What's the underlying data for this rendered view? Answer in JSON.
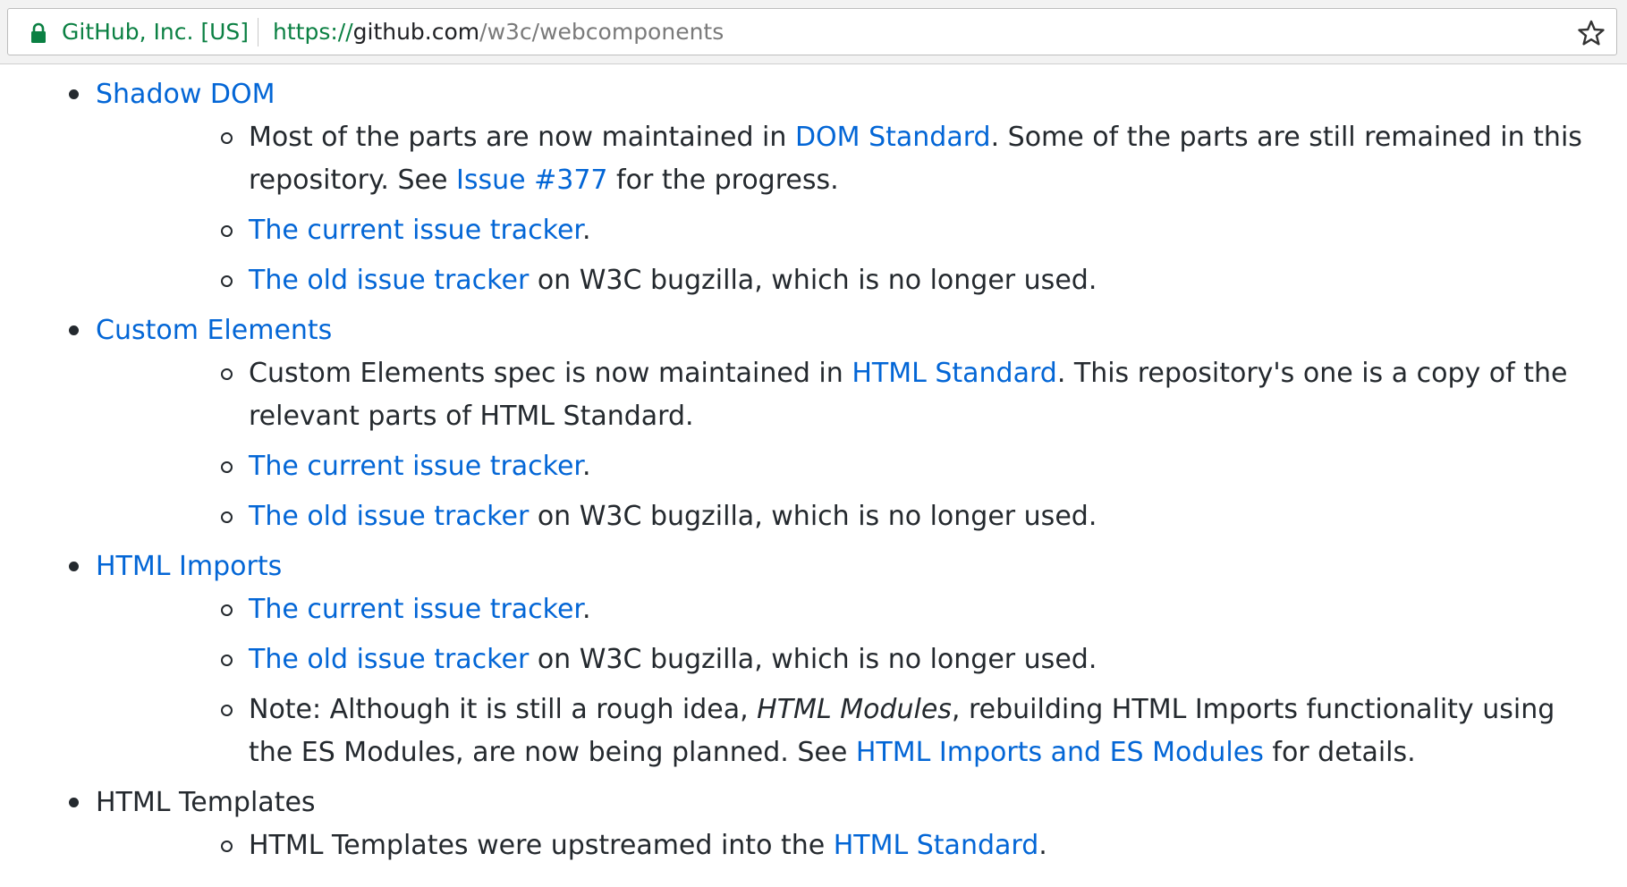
{
  "browser": {
    "site_identity": "GitHub, Inc. [US]",
    "url_scheme": "https://",
    "url_host": "github.com",
    "url_path": "/w3c/webcomponents",
    "secure_color": "#0b8043"
  },
  "link_color": "#0366d6",
  "sections": {
    "shadow_dom": {
      "title": "Shadow DOM",
      "item1": {
        "before": "Most of the parts are now maintained in ",
        "link": "DOM Standard",
        "middle": ". Some of the parts are still remained in this repository. See ",
        "link2": "Issue #377",
        "after": " for the progress."
      },
      "item2": {
        "link": "The current issue tracker",
        "after": "."
      },
      "item3": {
        "link": "The old issue tracker",
        "after": " on W3C bugzilla, which is no longer used."
      }
    },
    "custom_elements": {
      "title": "Custom Elements",
      "item1": {
        "before": "Custom Elements spec is now maintained in ",
        "link": "HTML Standard",
        "after": ". This repository's one is a copy of the relevant parts of HTML Standard."
      },
      "item2": {
        "link": "The current issue tracker",
        "after": "."
      },
      "item3": {
        "link": "The old issue tracker",
        "after": " on W3C bugzilla, which is no longer used."
      }
    },
    "html_imports": {
      "title": "HTML Imports",
      "item1": {
        "link": "The current issue tracker",
        "after": "."
      },
      "item2": {
        "link": "The old issue tracker",
        "after": " on W3C bugzilla, which is no longer used."
      },
      "item3": {
        "before": "Note: Although it is still a rough idea, ",
        "emphasis": "HTML Modules",
        "middle": ", rebuilding HTML Imports functionality using the ES Modules, are now being planned. See ",
        "link": "HTML Imports and ES Modules",
        "after": " for details."
      }
    },
    "html_templates": {
      "title": "HTML Templates",
      "item1": {
        "before": "HTML Templates were upstreamed into the ",
        "link": "HTML Standard",
        "after": "."
      }
    }
  }
}
